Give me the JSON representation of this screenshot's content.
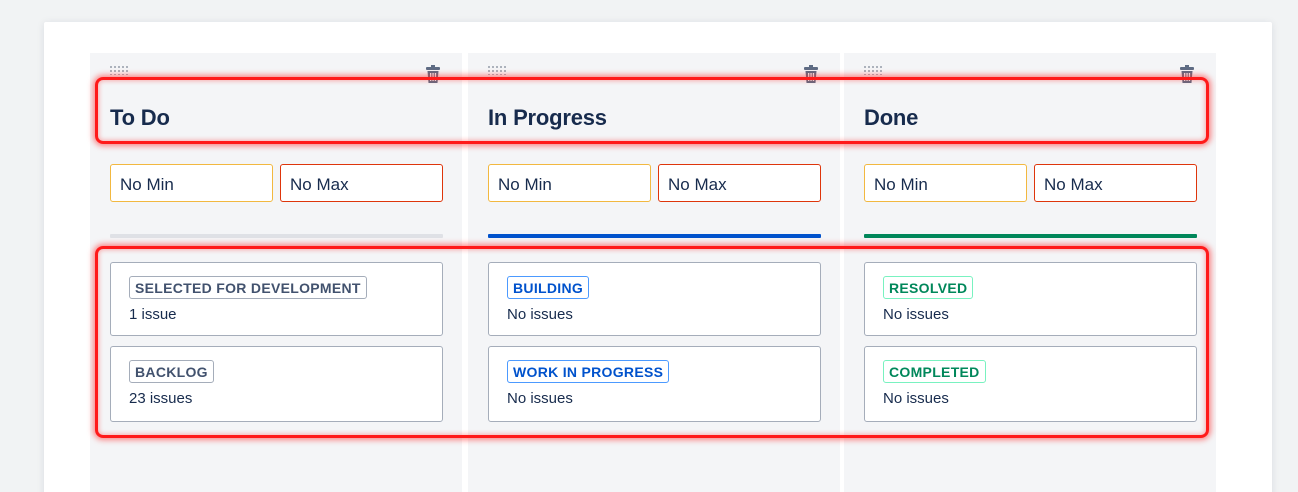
{
  "columns": [
    {
      "title": "To Do",
      "min_placeholder": "No Min",
      "max_placeholder": "No Max",
      "bar_color": "#dfe1e6",
      "statuses": [
        {
          "label": "SELECTED FOR DEVELOPMENT",
          "count": "1 issue",
          "style": "grey"
        },
        {
          "label": "BACKLOG",
          "count": "23 issues",
          "style": "grey"
        }
      ]
    },
    {
      "title": "In Progress",
      "min_placeholder": "No Min",
      "max_placeholder": "No Max",
      "bar_color": "#0052cc",
      "statuses": [
        {
          "label": "BUILDING",
          "count": "No issues",
          "style": "blue"
        },
        {
          "label": "WORK IN PROGRESS",
          "count": "No issues",
          "style": "blue"
        }
      ]
    },
    {
      "title": "Done",
      "min_placeholder": "No Min",
      "max_placeholder": "No Max",
      "bar_color": "#00875a",
      "statuses": [
        {
          "label": "RESOLVED",
          "count": "No issues",
          "style": "green"
        },
        {
          "label": "COMPLETED",
          "count": "No issues",
          "style": "green"
        }
      ]
    }
  ],
  "icons": {
    "drag_handle": "drag-handle-icon",
    "delete": "trash-icon"
  },
  "colors": {
    "highlight": "#ff1a1a",
    "min_border": "#f2b840",
    "max_border": "#de350b"
  }
}
